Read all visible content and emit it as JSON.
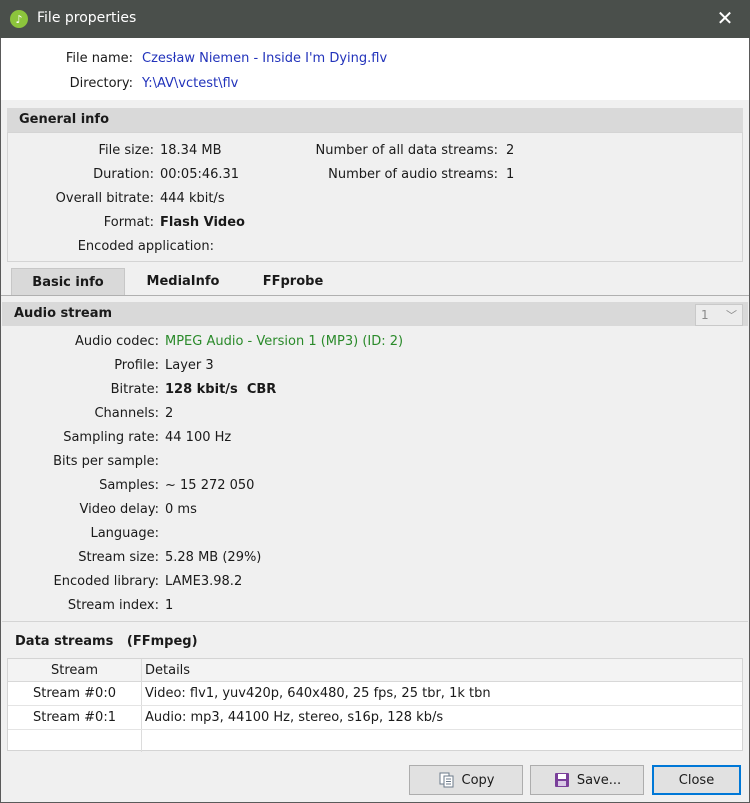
{
  "window": {
    "title": "File properties",
    "close_glyph": "✕",
    "app_icon": "music-note-icon",
    "app_icon_glyph": "♪"
  },
  "file": {
    "name_label": "File name:",
    "name_value": "Czesław Niemen - Inside I'm Dying.flv",
    "dir_label": "Directory:",
    "dir_value": "Y:\\AV\\vctest\\flv"
  },
  "general": {
    "heading": "General info",
    "left": [
      {
        "label": "File size:",
        "value": "18.34 MB"
      },
      {
        "label": "Duration:",
        "value": "00:05:46.31"
      },
      {
        "label": "Overall bitrate:",
        "value": "444 kbit/s"
      },
      {
        "label": "Format:",
        "value": "Flash Video"
      },
      {
        "label": "Encoded application:",
        "value": ""
      }
    ],
    "right": [
      {
        "label": "Number of all data streams:",
        "value": "2"
      },
      {
        "label": "Number of audio streams:",
        "value": "1"
      }
    ]
  },
  "tabs": [
    {
      "label": "Basic info",
      "active": true
    },
    {
      "label": "MediaInfo",
      "active": false
    },
    {
      "label": "FFprobe",
      "active": false
    }
  ],
  "audio": {
    "heading": "Audio stream",
    "stream_selector": {
      "value": "1",
      "arrow": "﹀"
    },
    "fields": [
      {
        "label": "Audio codec:",
        "value": "MPEG Audio - Version 1 (MP3) (ID: 2)"
      },
      {
        "label": "Profile:",
        "value": "Layer 3"
      },
      {
        "label": "Bitrate:",
        "value": "128 kbit/s  CBR"
      },
      {
        "label": "Channels:",
        "value": "2"
      },
      {
        "label": "Sampling rate:",
        "value": "44 100 Hz"
      },
      {
        "label": "Bits per sample:",
        "value": ""
      },
      {
        "label": "Samples:",
        "value": "~ 15 272 050"
      },
      {
        "label": "Video delay:",
        "value": "0 ms"
      },
      {
        "label": "Language:",
        "value": ""
      },
      {
        "label": "Stream size:",
        "value": "5.28 MB (29%)"
      },
      {
        "label": "Encoded library:",
        "value": "LAME3.98.2"
      },
      {
        "label": "Stream index:",
        "value": "1"
      }
    ]
  },
  "data_streams": {
    "heading": "Data streams   (FFmpeg)",
    "columns": [
      "Stream",
      "Details"
    ],
    "rows": [
      {
        "stream": "Stream #0:0",
        "details": "Video: flv1, yuv420p, 640x480, 25 fps, 25 tbr, 1k tbn"
      },
      {
        "stream": "Stream #0:1",
        "details": "Audio: mp3, 44100 Hz, stereo, s16p, 128 kb/s"
      }
    ]
  },
  "buttons": {
    "copy": "Copy",
    "save": "Save...",
    "close": "Close"
  },
  "colors": {
    "link": "#2233bb",
    "codec": "#2a8a2a",
    "titlebar": "#4a4f4b",
    "focus": "#0078d7"
  }
}
